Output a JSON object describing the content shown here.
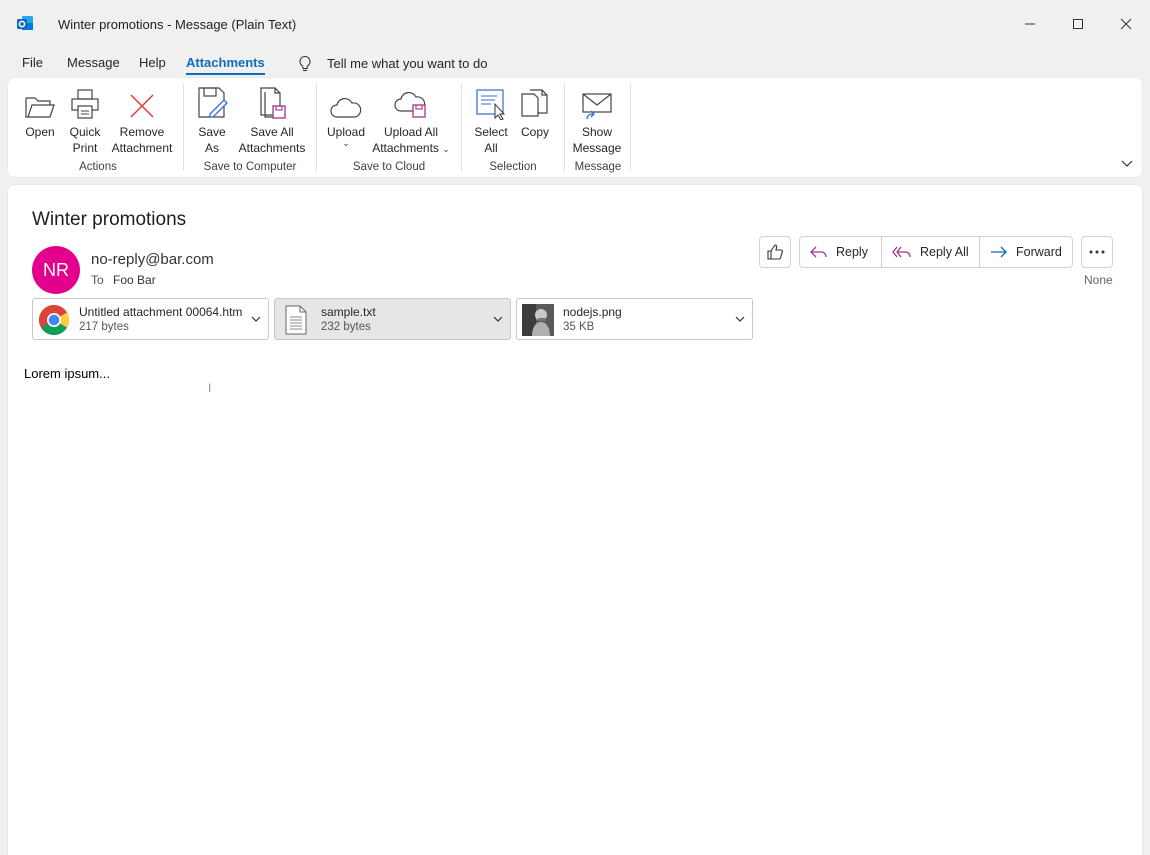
{
  "window": {
    "title": "Winter promotions  -  Message (Plain Text)",
    "app_icon": "outlook-icon",
    "accent": "#0f6cbd"
  },
  "menu": {
    "tabs": [
      "File",
      "Message",
      "Help",
      "Attachments"
    ],
    "active_tab": "Attachments",
    "tell_me": "Tell me what you want to do"
  },
  "ribbon": {
    "actions": {
      "label": "Actions",
      "open": "Open",
      "quick_print_1": "Quick",
      "quick_print_2": "Print",
      "remove_1": "Remove",
      "remove_2": "Attachment"
    },
    "save_to_computer": {
      "label": "Save to Computer",
      "save_as_1": "Save",
      "save_as_2": "As",
      "save_all_1": "Save All",
      "save_all_2": "Attachments"
    },
    "save_to_cloud": {
      "label": "Save to Cloud",
      "upload": "Upload",
      "upload_all_1": "Upload All",
      "upload_all_2": "Attachments"
    },
    "selection": {
      "label": "Selection",
      "select_all_1": "Select",
      "select_all_2": "All",
      "copy": "Copy"
    },
    "message": {
      "label": "Message",
      "show_1": "Show",
      "show_2": "Message"
    }
  },
  "email": {
    "subject": "Winter promotions",
    "avatar_initials": "NR",
    "avatar_color": "#e3008c",
    "sender": "no-reply@bar.com",
    "to_label": "To",
    "to": "Foo Bar",
    "actions": {
      "reply": "Reply",
      "reply_all": "Reply All",
      "forward": "Forward"
    },
    "category": "None",
    "attachments": [
      {
        "name": "Untitled attachment 00064.htm",
        "size": "217 bytes",
        "icon": "chrome-icon"
      },
      {
        "name": "sample.txt",
        "size": "232 bytes",
        "icon": "text-file-icon"
      },
      {
        "name": "nodejs.png",
        "size": "35 KB",
        "icon": "image-thumbnail"
      }
    ],
    "body": "Lorem ipsum..."
  }
}
